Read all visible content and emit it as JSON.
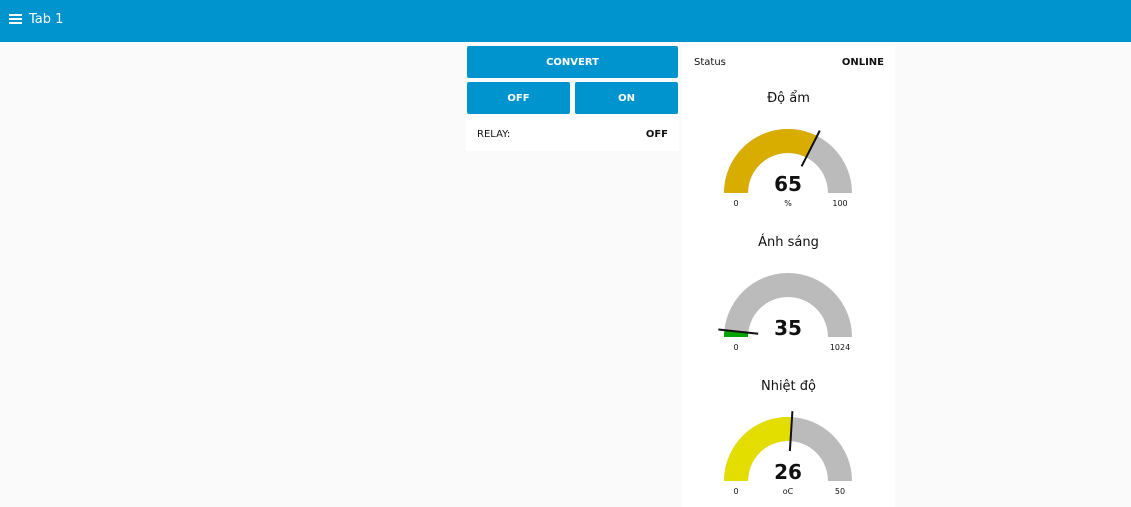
{
  "header": {
    "title": "Tab 1",
    "menu_icon": "menu-icon"
  },
  "controls": {
    "convert_label": "CONVERT",
    "off_label": "OFF",
    "on_label": "ON",
    "relay_label": "RELAY:",
    "relay_value": "OFF"
  },
  "status": {
    "label": "Status",
    "value": "ONLINE"
  },
  "gauges": [
    {
      "title": "Độ ẩm",
      "value": 65,
      "value_text": "65",
      "units": "%",
      "min": 0,
      "max": 100,
      "min_text": "0",
      "max_text": "100",
      "color": "#d8ad00"
    },
    {
      "title": "Ánh sáng",
      "value": 35,
      "value_text": "35",
      "units": "",
      "min": 0,
      "max": 1024,
      "min_text": "0",
      "max_text": "1024",
      "color": "#00a400"
    },
    {
      "title": "Nhiệt độ",
      "value": 26,
      "value_text": "26",
      "units": "oC",
      "min": 0,
      "max": 50,
      "min_text": "0",
      "max_text": "50",
      "color": "#e3dd00"
    }
  ]
}
